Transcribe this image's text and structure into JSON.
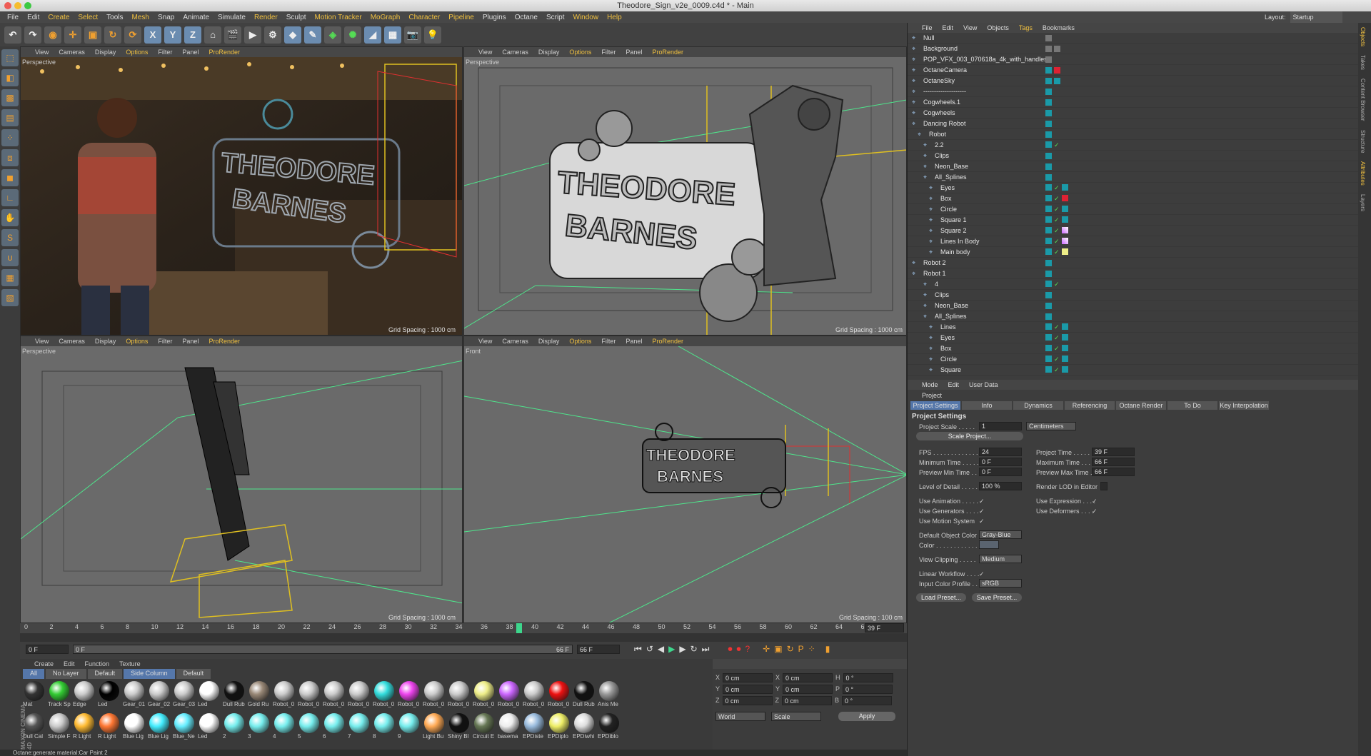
{
  "window": {
    "title": "Theodore_Sign_v2e_0009.c4d * - Main",
    "layout_label": "Layout:",
    "layout_value": "Startup"
  },
  "menu": [
    "File",
    "Edit",
    "Create",
    "Select",
    "Tools",
    "Mesh",
    "Snap",
    "Animate",
    "Simulate",
    "Render",
    "Sculpt",
    "Motion Tracker",
    "MoGraph",
    "Character",
    "Pipeline",
    "Plugins",
    "Octane",
    "Script",
    "Window",
    "Help"
  ],
  "toolbar": {
    "x": "X",
    "y": "Y",
    "z": "Z"
  },
  "viewport_menu": [
    "View",
    "Cameras",
    "Display",
    "Options",
    "Filter",
    "Panel",
    "ProRender"
  ],
  "viewports": [
    {
      "name": "Perspective",
      "grid": "Grid Spacing : 1000 cm"
    },
    {
      "name": "Perspective",
      "grid": "Grid Spacing : 1000 cm"
    },
    {
      "name": "Perspective",
      "grid": "Grid Spacing : 1000 cm"
    },
    {
      "name": "Front",
      "grid": "Grid Spacing : 100 cm"
    }
  ],
  "sign": {
    "line1": "THEODORE",
    "line2": "BARNES"
  },
  "timeline": {
    "ticks": [
      "0",
      "2",
      "4",
      "6",
      "8",
      "10",
      "12",
      "14",
      "16",
      "18",
      "20",
      "22",
      "24",
      "26",
      "28",
      "30",
      "32",
      "34",
      "36",
      "38",
      "40",
      "42",
      "44",
      "46",
      "48",
      "50",
      "52",
      "54",
      "56",
      "58",
      "60",
      "62",
      "64",
      "66"
    ],
    "current": "39",
    "end": "39 F",
    "start_field": "0 F",
    "range_start": "0 F",
    "range_end": "66 F",
    "end_field": "66 F"
  },
  "materials": {
    "menu": [
      "Create",
      "Edit",
      "Function",
      "Texture"
    ],
    "tabs": [
      "All",
      "No Layer",
      "Default",
      "Side Column",
      "Default"
    ],
    "row1": [
      {
        "n": "Mat",
        "c": "#333"
      },
      {
        "n": "Track Sp",
        "c": "#3c3"
      },
      {
        "n": "Edge",
        "c": "#ccc"
      },
      {
        "n": "Led",
        "c": "#000"
      },
      {
        "n": "Gear_01",
        "c": "#ccc"
      },
      {
        "n": "Gear_02",
        "c": "#ccc"
      },
      {
        "n": "Gear_03",
        "c": "#ccc"
      },
      {
        "n": "Led",
        "c": "#fff"
      },
      {
        "n": "Dull Rub",
        "c": "#111"
      },
      {
        "n": "Gold Ru",
        "c": "#987"
      },
      {
        "n": "Robot_0",
        "c": "#ccc"
      },
      {
        "n": "Robot_0",
        "c": "#ccc"
      },
      {
        "n": "Robot_0",
        "c": "#ccc"
      },
      {
        "n": "Robot_0",
        "c": "#ccc"
      },
      {
        "n": "Robot_0",
        "c": "#3dd"
      },
      {
        "n": "Robot_0",
        "c": "#e4e"
      },
      {
        "n": "Robot_0",
        "c": "#ccc"
      },
      {
        "n": "Robot_0",
        "c": "#ccc"
      },
      {
        "n": "Robot_0",
        "c": "#ee8"
      },
      {
        "n": "Robot_0",
        "c": "#c6f"
      },
      {
        "n": "Robot_0",
        "c": "#ccc"
      },
      {
        "n": "Robot_0",
        "c": "#e11"
      },
      {
        "n": "Dull Rub",
        "c": "#111"
      },
      {
        "n": "Anis Me",
        "c": "#999"
      }
    ],
    "row2": [
      {
        "n": "Dull Cal",
        "c": "#555"
      },
      {
        "n": "Simple F",
        "c": "#ccc"
      },
      {
        "n": "R Light",
        "c": "#fb3"
      },
      {
        "n": "R Light",
        "c": "#f73"
      },
      {
        "n": "Blue Lig",
        "c": "#fff"
      },
      {
        "n": "Blue Lig",
        "c": "#4ef"
      },
      {
        "n": "Blue_Ne",
        "c": "#6ef"
      },
      {
        "n": "Led",
        "c": "#fff"
      },
      {
        "n": "2",
        "c": "#7ee"
      },
      {
        "n": "3",
        "c": "#7ee"
      },
      {
        "n": "4",
        "c": "#7ee"
      },
      {
        "n": "5",
        "c": "#7ee"
      },
      {
        "n": "6",
        "c": "#7ee"
      },
      {
        "n": "7",
        "c": "#7ee"
      },
      {
        "n": "8",
        "c": "#7ee"
      },
      {
        "n": "9",
        "c": "#7ee"
      },
      {
        "n": "Light Bu",
        "c": "#fa5"
      },
      {
        "n": "Shiny Bl",
        "c": "#111"
      },
      {
        "n": "Circuit E",
        "c": "#675"
      },
      {
        "n": "basema",
        "c": "#eee"
      },
      {
        "n": "EPDiste",
        "c": "#9bd"
      },
      {
        "n": "EPDiplo",
        "c": "#ee6"
      },
      {
        "n": "EPDiwhi",
        "c": "#ddd"
      },
      {
        "n": "EPDiblo",
        "c": "#222"
      }
    ]
  },
  "coords": {
    "rows": [
      [
        "X",
        "0 cm",
        "X",
        "0 cm",
        "H",
        "0 °"
      ],
      [
        "Y",
        "0 cm",
        "Y",
        "0 cm",
        "P",
        "0 °"
      ],
      [
        "Z",
        "0 cm",
        "Z",
        "0 cm",
        "B",
        "0 °"
      ]
    ],
    "world": "World",
    "scale": "Scale",
    "apply": "Apply"
  },
  "status": "Octane:generate material:Car Paint 2",
  "objects": {
    "menu": [
      "File",
      "Edit",
      "View",
      "Objects",
      "Tags",
      "Bookmarks"
    ],
    "rows": [
      {
        "d": 0,
        "n": "Null",
        "t": [
          "w"
        ]
      },
      {
        "d": 0,
        "n": "Background",
        "t": [
          "w",
          "x"
        ]
      },
      {
        "d": 0,
        "n": "POP_VFX_003_070618a_4k_with_handles",
        "t": [
          "w"
        ]
      },
      {
        "d": 0,
        "n": "OctaneCamera",
        "t": [
          "c",
          "r"
        ]
      },
      {
        "d": 0,
        "n": "OctaneSky",
        "t": [
          "c",
          "b"
        ]
      },
      {
        "d": 0,
        "n": "--------------------",
        "t": [
          "c"
        ]
      },
      {
        "d": 0,
        "n": "Cogwheels.1",
        "t": [
          "c"
        ]
      },
      {
        "d": 0,
        "n": "Cogwheels",
        "t": [
          "c"
        ]
      },
      {
        "d": 0,
        "n": "Dancing Robot",
        "t": [
          "c"
        ]
      },
      {
        "d": 1,
        "n": "Robot",
        "t": [
          "c"
        ]
      },
      {
        "d": 2,
        "n": "2.2",
        "t": [
          "c",
          "g"
        ]
      },
      {
        "d": 2,
        "n": "Clips",
        "t": [
          "c"
        ]
      },
      {
        "d": 2,
        "n": "Neon_Base",
        "t": [
          "c"
        ]
      },
      {
        "d": 2,
        "n": "All_Splines",
        "t": [
          "c"
        ]
      },
      {
        "d": 3,
        "n": "Eyes",
        "t": [
          "c",
          "g",
          "c"
        ]
      },
      {
        "d": 3,
        "n": "Box",
        "t": [
          "c",
          "g",
          "r"
        ]
      },
      {
        "d": 3,
        "n": "Circle",
        "t": [
          "c",
          "g",
          "c"
        ]
      },
      {
        "d": 3,
        "n": "Square 1",
        "t": [
          "c",
          "g",
          "c"
        ]
      },
      {
        "d": 3,
        "n": "Square 2",
        "t": [
          "c",
          "g",
          "p"
        ]
      },
      {
        "d": 3,
        "n": "Lines In Body",
        "t": [
          "c",
          "g",
          "p"
        ]
      },
      {
        "d": 3,
        "n": "Main body",
        "t": [
          "c",
          "g",
          "y"
        ]
      },
      {
        "d": 0,
        "n": "Robot 2",
        "t": [
          "c"
        ]
      },
      {
        "d": 0,
        "n": "Robot 1",
        "t": [
          "c"
        ]
      },
      {
        "d": 2,
        "n": "4",
        "t": [
          "c",
          "g"
        ]
      },
      {
        "d": 2,
        "n": "Clips",
        "t": [
          "c"
        ]
      },
      {
        "d": 2,
        "n": "Neon_Base",
        "t": [
          "c"
        ]
      },
      {
        "d": 2,
        "n": "All_Splines",
        "t": [
          "c"
        ]
      },
      {
        "d": 3,
        "n": "Lines",
        "t": [
          "c",
          "g",
          "c"
        ]
      },
      {
        "d": 3,
        "n": "Eyes",
        "t": [
          "c",
          "g",
          "c"
        ]
      },
      {
        "d": 3,
        "n": "Box",
        "t": [
          "c",
          "g",
          "c"
        ]
      },
      {
        "d": 3,
        "n": "Circle",
        "t": [
          "c",
          "g",
          "c"
        ]
      },
      {
        "d": 3,
        "n": "Square",
        "t": [
          "c",
          "g",
          "c"
        ]
      }
    ]
  },
  "attributes": {
    "menu": [
      "Mode",
      "Edit",
      "User Data"
    ],
    "header": "Project",
    "tabs": [
      "Project Settings",
      "Info",
      "Dynamics",
      "Referencing",
      "Octane Render",
      "To Do",
      "Key Interpolation"
    ],
    "section": "Project Settings",
    "project_scale": "Project Scale . . . . .",
    "project_scale_val": "1",
    "units": "Centimeters",
    "scale_project": "Scale Project...",
    "fps": "FPS . . . . . . . . . . . . .",
    "fps_val": "24",
    "project_time": "Project Time . . . . .",
    "project_time_val": "39 F",
    "min_time": "Minimum Time . . . . .",
    "min_time_val": "0 F",
    "max_time": "Maximum Time . . . .",
    "max_time_val": "66 F",
    "prev_min": "Preview Min Time . .",
    "prev_min_val": "0 F",
    "prev_max": "Preview Max Time . .",
    "prev_max_val": "66 F",
    "lod": "Level of Detail . . . . .",
    "lod_val": "100 %",
    "render_lod": "Render LOD in Editor",
    "use_anim": "Use Animation . . . . .",
    "use_expr": "Use Expression . . . .",
    "use_gen": "Use Generators . . . .",
    "use_def": "Use Deformers . . . .",
    "use_motion": "Use Motion System",
    "def_color": "Default Object Color",
    "def_color_val": "Gray-Blue",
    "color": "Color . . . . . . . . . . . .",
    "view_clip": "View Clipping . . . . .",
    "view_clip_val": "Medium",
    "linear": "Linear Workflow . . . .",
    "input_profile": "Input Color Profile . .",
    "input_profile_val": "sRGB",
    "load_preset": "Load Preset...",
    "save_preset": "Save Preset..."
  },
  "right_tabs": [
    "Objects",
    "Takes",
    "Content Browser",
    "Structure",
    "Attributes",
    "Layers"
  ],
  "brand": "MAXON CINEMA 4D"
}
